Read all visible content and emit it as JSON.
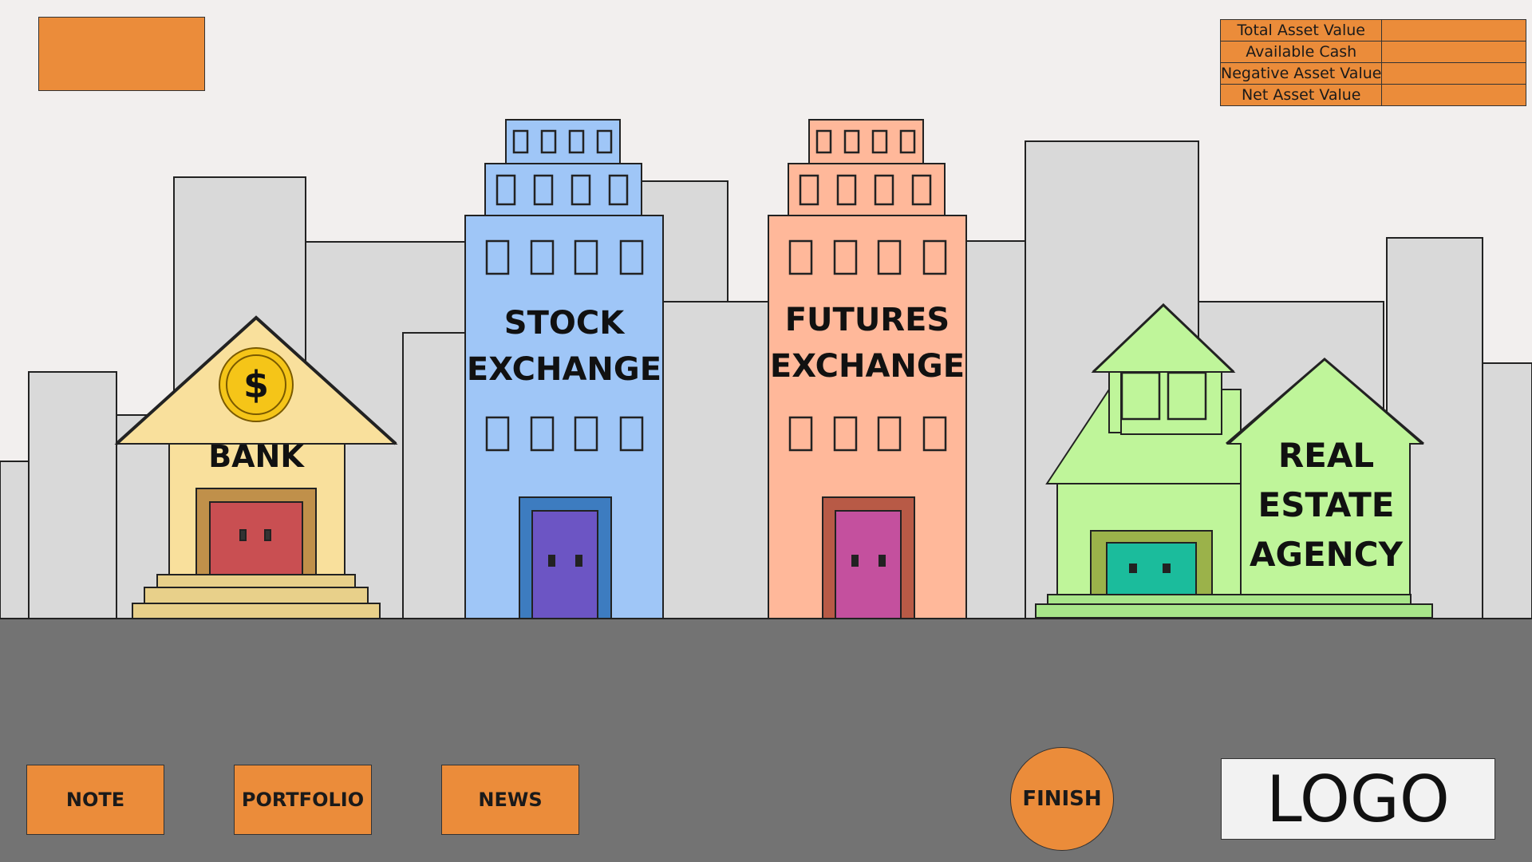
{
  "title_box": "",
  "stats": {
    "rows": [
      {
        "label": "Total Asset Value",
        "value": ""
      },
      {
        "label": "Available Cash",
        "value": ""
      },
      {
        "label": "Negative Asset Value",
        "value": ""
      },
      {
        "label": "Net Asset Value",
        "value": ""
      }
    ]
  },
  "buildings": {
    "bank": {
      "label": "BANK",
      "coin_symbol": "$"
    },
    "stock": {
      "line1": "STOCK",
      "line2": "EXCHANGE"
    },
    "futures": {
      "line1": "FUTURES",
      "line2": "EXCHANGE"
    },
    "realestate": {
      "line1": "REAL",
      "line2": "ESTATE",
      "line3": "AGENCY"
    }
  },
  "buttons": {
    "note": "NOTE",
    "portfolio": "PORTFOLIO",
    "news": "NEWS",
    "finish": "FINISH"
  },
  "logo": "LOGO",
  "colors": {
    "accent": "#eb8c3a",
    "ground": "#737373",
    "bank": "#f9e09c",
    "stock": "#9fc6f7",
    "futures": "#ffb89a",
    "realestate": "#bff59a"
  }
}
